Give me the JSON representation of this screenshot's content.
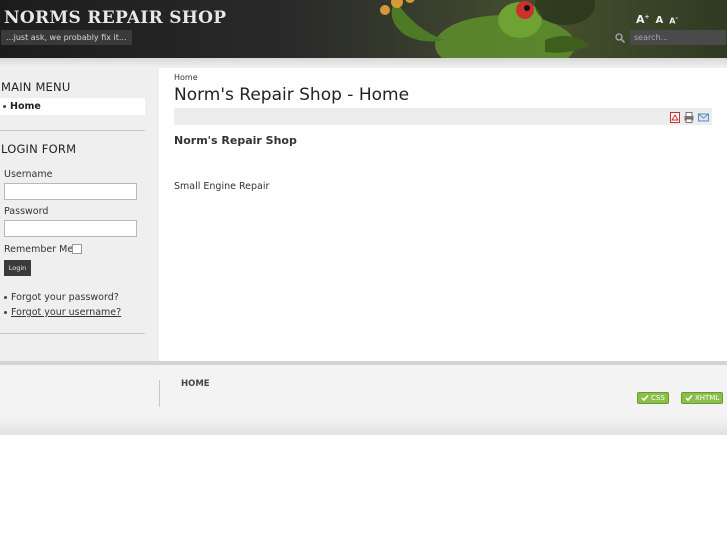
{
  "header": {
    "site_title": "NORMS REPAIR SHOP",
    "tagline": "...just ask, we probably fix it...",
    "font_tools": {
      "increase": "A",
      "reset": "A",
      "decrease": "A"
    },
    "search_placeholder": "search..."
  },
  "sidebar": {
    "main_menu_title": "MAIN MENU",
    "menu_items": [
      {
        "label": "Home"
      }
    ],
    "login_title": "LOGIN FORM",
    "username_label": "Username",
    "password_label": "Password",
    "remember_label": "Remember Me",
    "login_button": "Login",
    "forgot_password": "Forgot your password?",
    "forgot_username": "Forgot your username?"
  },
  "main": {
    "breadcrumb": "Home",
    "page_title": "Norm's Repair Shop - Home",
    "article_title": "Norm's Repair Shop",
    "article_body": "Small Engine Repair"
  },
  "footer": {
    "nav_home": "HOME",
    "badge_css": "CSS",
    "badge_xhtml": "XHTML"
  },
  "colors": {
    "header_dark": "#2a2a2a",
    "sidebar_bg": "#efefef",
    "badge_green": "#8cbf4a",
    "frog_green": "#7ab83a",
    "frog_red": "#c8322a"
  }
}
